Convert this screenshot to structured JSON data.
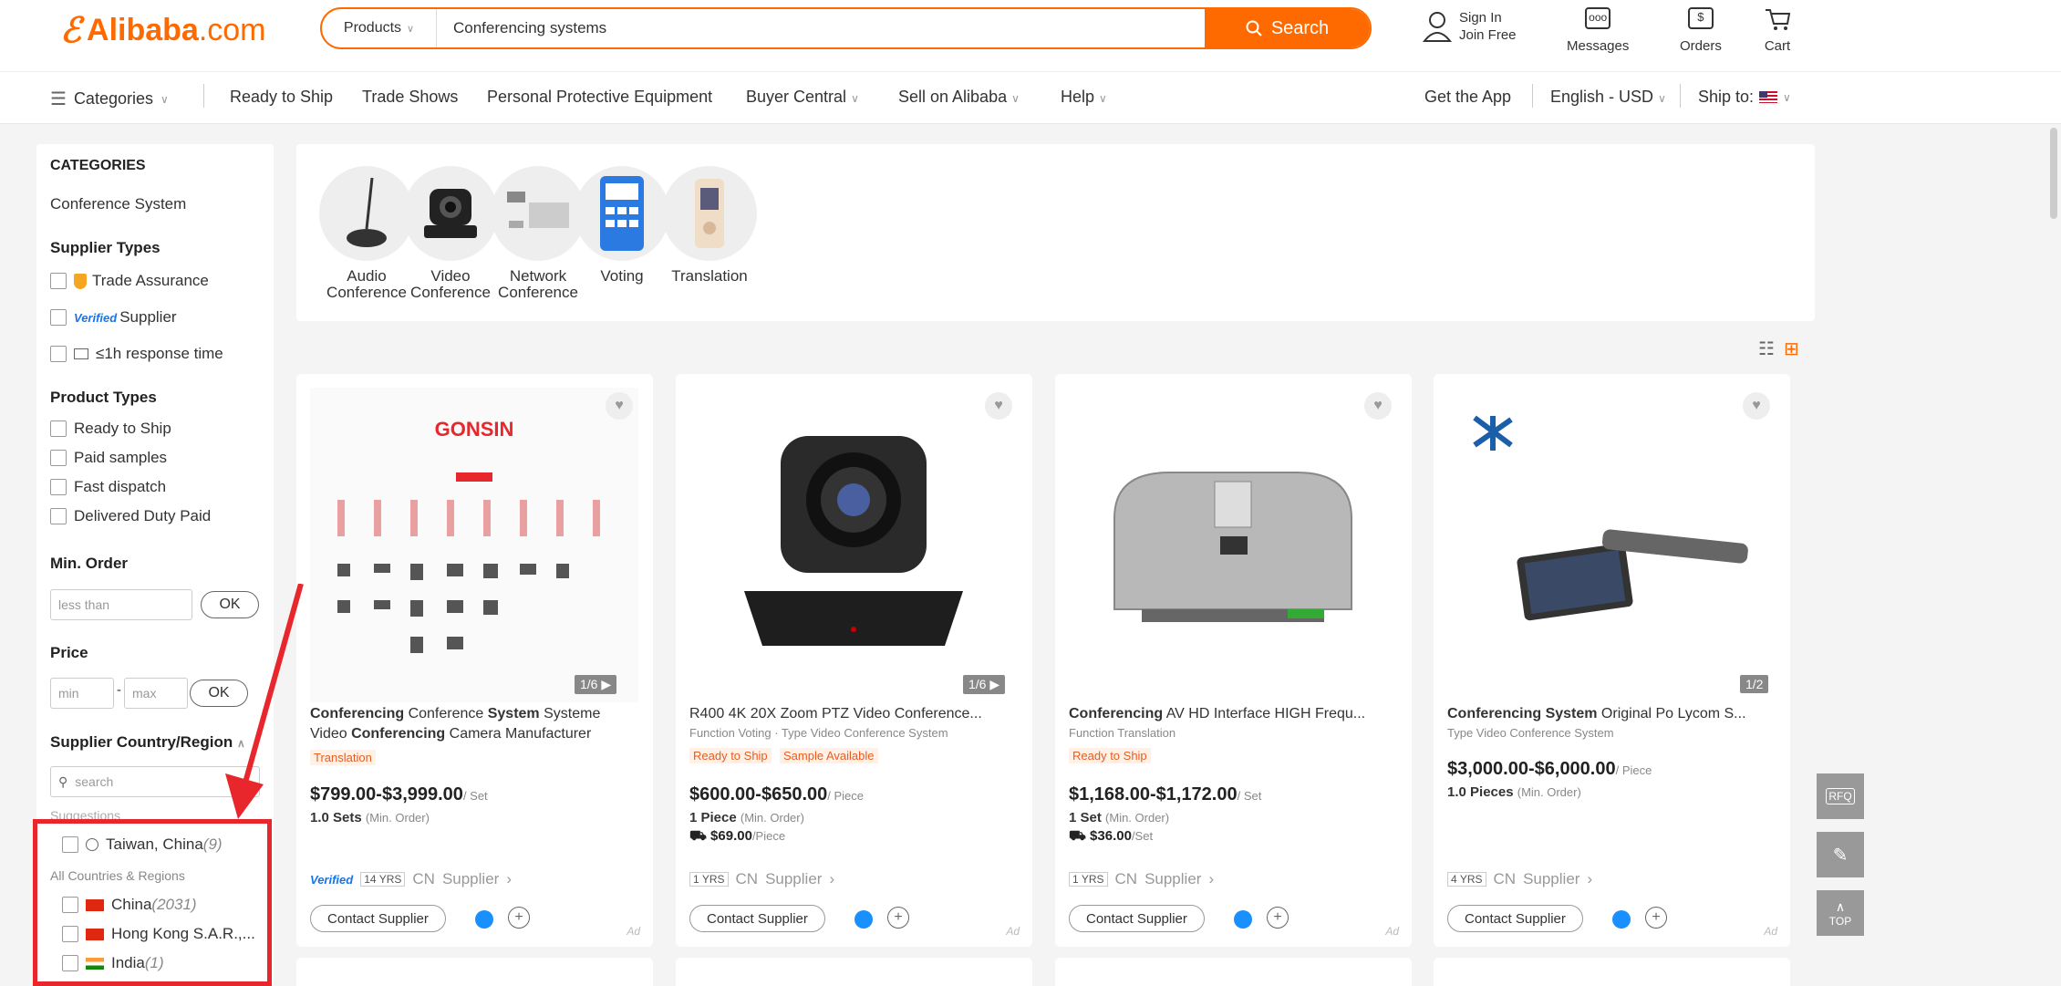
{
  "header": {
    "logo": {
      "brand": "Alibaba",
      "domain": ".com"
    },
    "search": {
      "category": "Products",
      "query": "Conferencing systems",
      "button": "Search"
    },
    "sign_in": "Sign In",
    "join_free": "Join Free",
    "messages": "Messages",
    "orders": "Orders",
    "cart": "Cart"
  },
  "nav": {
    "categories": "Categories",
    "items": [
      "Ready to Ship",
      "Trade Shows",
      "Personal Protective Equipment",
      "Buyer Central",
      "Sell on Alibaba",
      "Help"
    ],
    "get_app": "Get the App",
    "language": "English - USD",
    "ship_to": "Ship to:"
  },
  "sidebar": {
    "categories_title": "CATEGORIES",
    "category": "Conference System",
    "supplier_types_title": "Supplier Types",
    "supplier_types": [
      "Trade Assurance",
      "Supplier",
      "≤1h response time"
    ],
    "verified_badge": "Verified",
    "product_types_title": "Product Types",
    "product_types": [
      "Ready to Ship",
      "Paid samples",
      "Fast dispatch",
      "Delivered Duty Paid"
    ],
    "min_order_title": "Min. Order",
    "min_order_placeholder": "less than",
    "ok": "OK",
    "price_title": "Price",
    "price_min": "min",
    "price_max": "max",
    "country_title": "Supplier Country/Region",
    "country_search": "search",
    "suggestions_label": "Suggestions",
    "suggestion": {
      "name": "Taiwan, China",
      "count": "(9)"
    },
    "all_label": "All Countries & Regions",
    "countries": [
      {
        "name": "China",
        "count": "(2031)"
      },
      {
        "name": "Hong Kong S.A.R.,...",
        "count": ""
      },
      {
        "name": "India",
        "count": "(1)"
      }
    ]
  },
  "category_strip": [
    {
      "label": "Audio Conference",
      "icon": "microphone-icon"
    },
    {
      "label": "Video Conference",
      "icon": "camera-icon"
    },
    {
      "label": "Network Conference",
      "icon": "network-icon"
    },
    {
      "label": "Voting",
      "icon": "voting-icon"
    },
    {
      "label": "Translation",
      "icon": "translation-icon"
    }
  ],
  "products": [
    {
      "title_html": "Conferencing Conference System Systeme Video Conferencing Camera Manufacturer",
      "tags": [
        "Translation"
      ],
      "price": "$799.00-$3,999.00",
      "unit": "/ Set",
      "moq": "1.0 Sets",
      "moq_label": "(Min. Order)",
      "ship": "",
      "years": "14",
      "verified": "Verified",
      "country": "CN",
      "supplier": "Supplier",
      "pager": "1/6",
      "brand_text": "GONSIN"
    },
    {
      "title_html": "R400 4K 20X Zoom PTZ Video Conference...",
      "subtitle": "Function Voting · Type Video Conference System",
      "tags": [
        "Ready to Ship",
        "Sample Available"
      ],
      "price": "$600.00-$650.00",
      "unit": "/ Piece",
      "moq": "1 Piece",
      "moq_label": "(Min. Order)",
      "ship": "$69.00",
      "ship_unit": "/Piece",
      "years": "1",
      "country": "CN",
      "supplier": "Supplier",
      "pager": "1/6"
    },
    {
      "title_html": "Conferencing AV HD Interface HIGH Frequ...",
      "subtitle": "Function Translation",
      "tags": [
        "Ready to Ship"
      ],
      "price": "$1,168.00-$1,172.00",
      "unit": "/ Set",
      "moq": "1 Set",
      "moq_label": "(Min. Order)",
      "ship": "$36.00",
      "ship_unit": "/Set",
      "years": "1",
      "country": "CN",
      "supplier": "Supplier"
    },
    {
      "title_html": "Conferencing System Original Po Lycom S...",
      "subtitle": "Type Video Conference System",
      "tags": [],
      "price": "$3,000.00-$6,000.00",
      "unit": "/ Piece",
      "moq": "1.0 Pieces",
      "moq_label": "(Min. Order)",
      "ship": "",
      "years": "4",
      "country": "CN",
      "supplier": "Supplier",
      "pager": "1/2"
    }
  ],
  "contact_label": "Contact Supplier",
  "yrs_suffix": "YRS",
  "ad_label": "Ad",
  "float": {
    "rfq": "RFQ",
    "top": "TOP"
  },
  "colors": {
    "brand": "#ff6a00",
    "annotation": "#e8272d",
    "verified": "#1a73e8"
  }
}
